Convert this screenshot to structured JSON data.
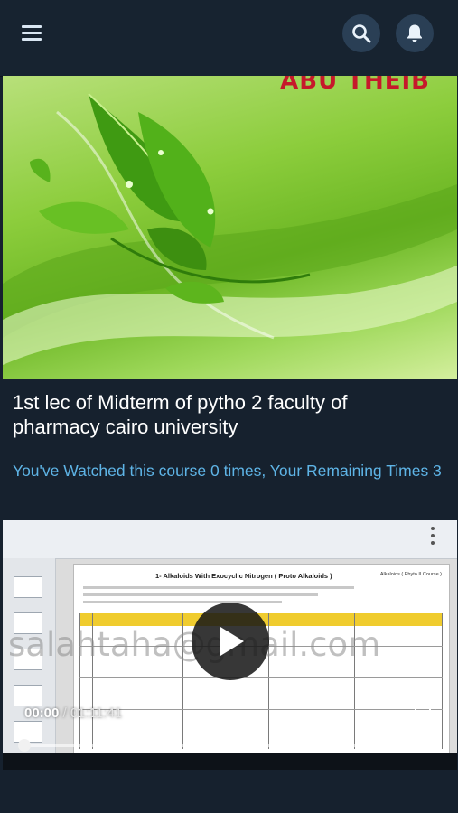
{
  "app": {
    "menu_icon": "hamburger-menu-icon",
    "search_icon": "search-icon",
    "notifications_icon": "bell-icon",
    "accent_color": "#5eb4e6"
  },
  "hero": {
    "brand_text": "ABU THEIB",
    "image": "green-leaves-banner"
  },
  "course": {
    "title": "1st lec of Midterm of pytho 2 faculty of pharmacy cairo university",
    "watch_info": "You've Watched this course 0 times, Your Remaining Times 3"
  },
  "player": {
    "slide_heading": "1- Alkaloids With Exocyclic Nitrogen ( Proto Alkaloids )",
    "slide_badge": "Alkaloids ( Phyto II Course )",
    "watermark": "salahtaha@gmail.com",
    "current_time": "00:00",
    "separator": " / ",
    "duration": "01:11:41",
    "progress": 0,
    "icons": [
      "play-icon",
      "fullscreen-icon",
      "more-vert-icon"
    ]
  }
}
